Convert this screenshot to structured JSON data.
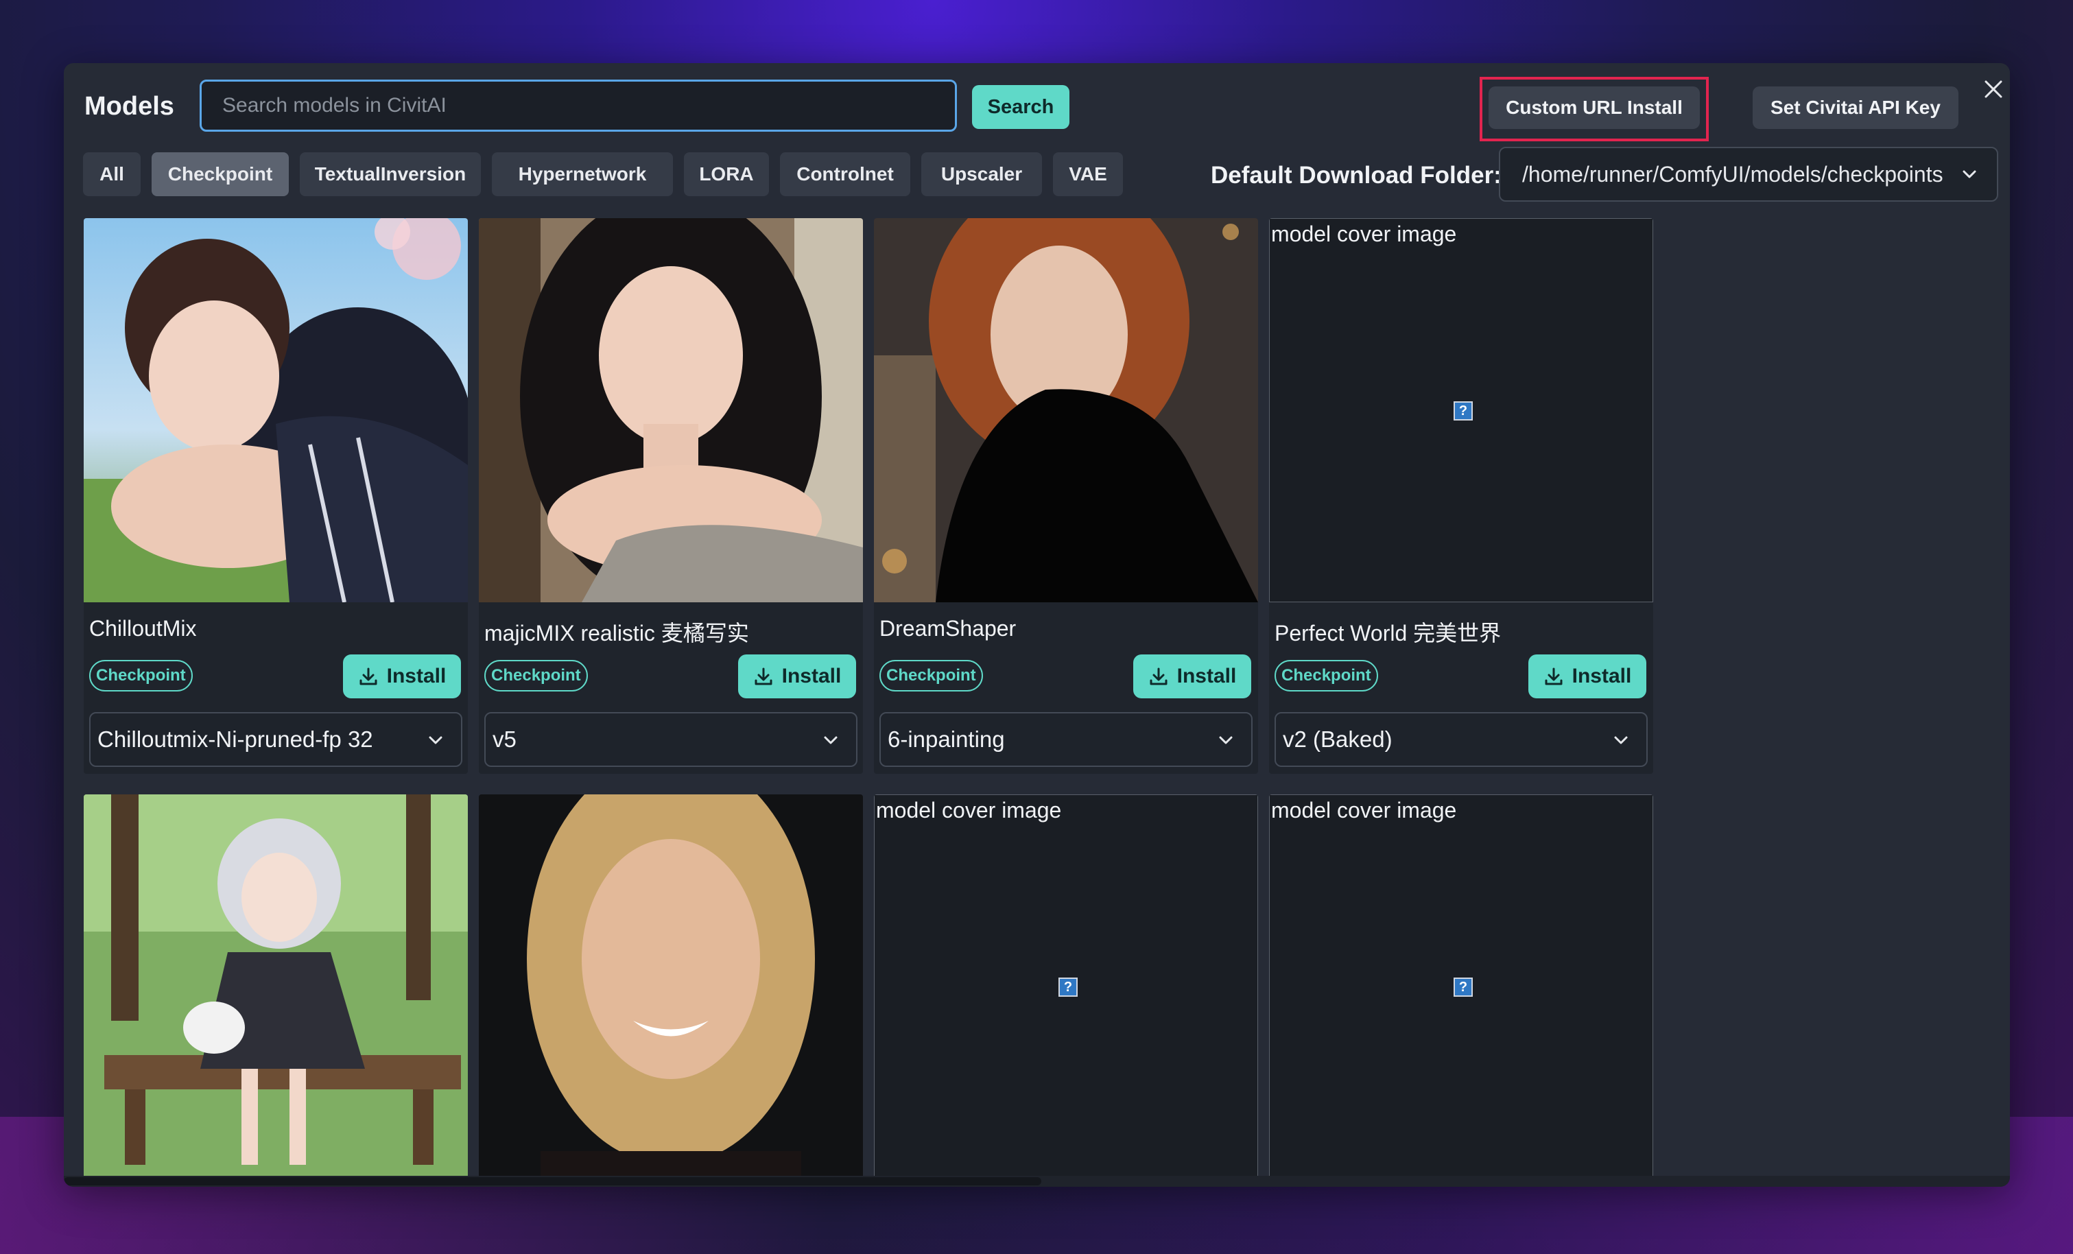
{
  "dialog": {
    "title": "Models",
    "search": {
      "placeholder": "Search models in CivitAI",
      "value": ""
    },
    "search_button": "Search",
    "custom_url_button": "Custom URL Install",
    "api_key_button": "Set Civitai API Key",
    "close_icon": "close-icon"
  },
  "filters": [
    {
      "label": "All",
      "active": false
    },
    {
      "label": "Checkpoint",
      "active": true
    },
    {
      "label": "TextualInversion",
      "active": false
    },
    {
      "label": "Hypernetwork",
      "active": false
    },
    {
      "label": "LORA",
      "active": false
    },
    {
      "label": "Controlnet",
      "active": false
    },
    {
      "label": "Upscaler",
      "active": false
    },
    {
      "label": "VAE",
      "active": false
    }
  ],
  "download_folder": {
    "label": "Default Download Folder:",
    "value": "/home/runner/ComfyUI/models/checkpoints"
  },
  "cards": [
    {
      "name": "ChilloutMix",
      "type": "Checkpoint",
      "install": "Install",
      "version": "Chilloutmix-Ni-pruned-fp 32",
      "cover": "photo-portrait-girl-dress"
    },
    {
      "name": "majicMIX realistic 麦橘写实",
      "type": "Checkpoint",
      "install": "Install",
      "version": "v5",
      "cover": "photo-portrait-woman-sweater"
    },
    {
      "name": "DreamShaper",
      "type": "Checkpoint",
      "install": "Install",
      "version": "6-inpainting",
      "cover": "painting-portrait-redhead"
    },
    {
      "name": "Perfect World 完美世界",
      "type": "Checkpoint",
      "install": "Install",
      "version": "v2 (Baked)",
      "cover_alt": "model cover image"
    }
  ],
  "row2": [
    {
      "cover": "anime-girl-bench-rabbit"
    },
    {
      "cover": "photo-portrait-blonde-smiling"
    },
    {
      "cover_alt": "model cover image"
    },
    {
      "cover_alt": "model cover image"
    }
  ]
}
